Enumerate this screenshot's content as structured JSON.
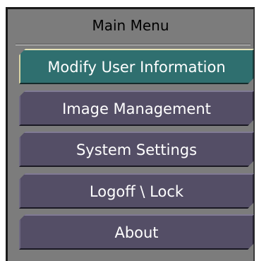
{
  "menu": {
    "title": "Main Menu",
    "items": [
      {
        "label": "Modify User Information",
        "active": true
      },
      {
        "label": "Image Management",
        "active": false
      },
      {
        "label": "System Settings",
        "active": false
      },
      {
        "label": "Logoff \\ Lock",
        "active": false
      },
      {
        "label": "About",
        "active": false
      }
    ]
  },
  "colors": {
    "panel_bg": "#7c7c7c",
    "button_bg": "#544e66",
    "button_active_bg": "#2f6f6f",
    "active_border": "#e6e3b8",
    "text": "#ffffff"
  }
}
